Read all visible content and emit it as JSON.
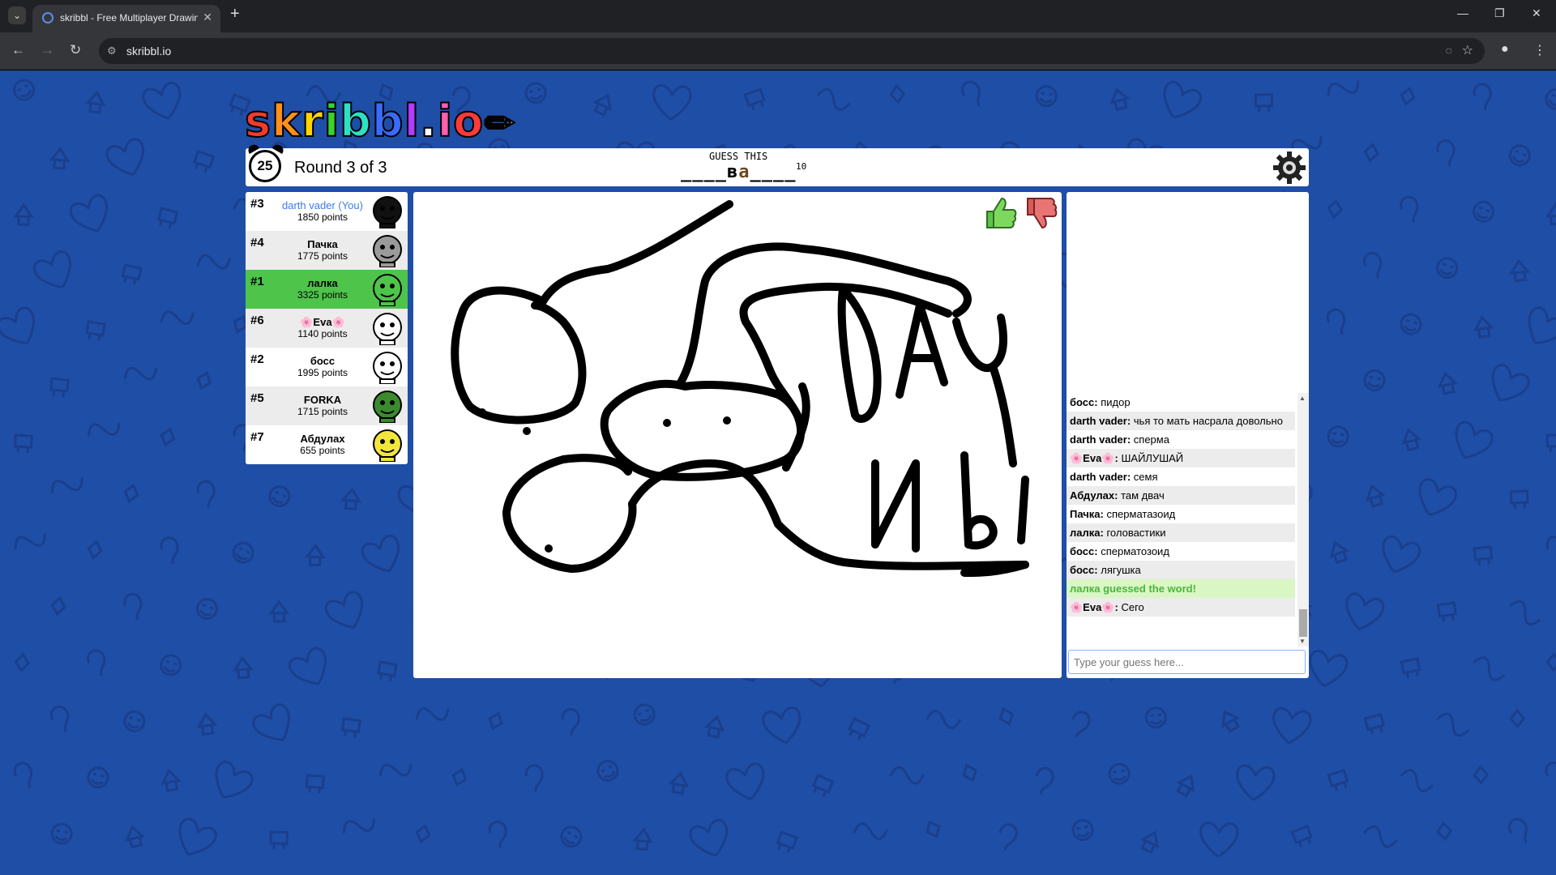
{
  "browser": {
    "tab_title": "skribbl - Free Multiplayer Drawing",
    "url": "skribbl.io"
  },
  "logo": [
    "s",
    "k",
    "r",
    "i",
    "b",
    "b",
    "l",
    ".",
    "i",
    "o"
  ],
  "logo_colors": [
    "#f53a2b",
    "#ff8f1c",
    "#ffd500",
    "#3bd12e",
    "#2ee0c3",
    "#3a6bff",
    "#b43bff",
    "#ffffff",
    "#ff5fae",
    "#ff3a3a"
  ],
  "header": {
    "timer": "25",
    "round": "Round 3 of 3",
    "guess_label": "GUESS THIS",
    "hint_prefix": "____в",
    "hint_reveal": "а",
    "hint_suffix": "____",
    "hint_count": "10"
  },
  "players": [
    {
      "rank": "#3",
      "name": "darth vader (You)",
      "points": "1850 points",
      "you": true,
      "avatar": "black-helmet-avatar",
      "color": "#111111"
    },
    {
      "rank": "#4",
      "name": "Пачка",
      "points": "1775 points",
      "avatar": "grey-goggles-avatar",
      "color": "#9a9a9a"
    },
    {
      "rank": "#1",
      "name": "лалка",
      "points": "3325 points",
      "avatar": "green-alien-avatar",
      "color": "#4ec44a"
    },
    {
      "rank": "#6",
      "name": "🌸Eva🌸",
      "points": "1140 points",
      "avatar": "white-smile-avatar",
      "color": "#ffffff"
    },
    {
      "rank": "#2",
      "name": "босс",
      "points": "1995 points",
      "avatar": "white-grin-avatar",
      "color": "#ffffff"
    },
    {
      "rank": "#5",
      "name": "FORKA",
      "points": "1715 points",
      "avatar": "green-drawing-avatar",
      "color": "#3c8a2e"
    },
    {
      "rank": "#7",
      "name": "Абдулах",
      "points": "655 points",
      "avatar": "yellow-avatar",
      "color": "#f2e53c"
    }
  ],
  "chat": [
    {
      "user": "босс",
      "text": "пидор"
    },
    {
      "user": "darth vader",
      "text": "чья то мать насрала довольно"
    },
    {
      "user": "darth vader",
      "text": "сперма"
    },
    {
      "user": "🌸Eva🌸",
      "text": "ШАЙЛУШАЙ"
    },
    {
      "user": "darth vader",
      "text": "семя"
    },
    {
      "user": "Абдулах",
      "text": "там двач"
    },
    {
      "user": "Пачка",
      "text": "сперматазоид"
    },
    {
      "user": "лалка",
      "text": "головастики"
    },
    {
      "user": "босс",
      "text": "сперматозоид"
    },
    {
      "user": "босс",
      "text": "лягушка"
    },
    {
      "system": "лалка guessed the word!"
    },
    {
      "user": "🌸Eva🌸",
      "text": "Сего"
    }
  ],
  "chat_input_placeholder": "Type your guess here...",
  "canvas_text": [
    "DAY",
    "И Ы"
  ]
}
